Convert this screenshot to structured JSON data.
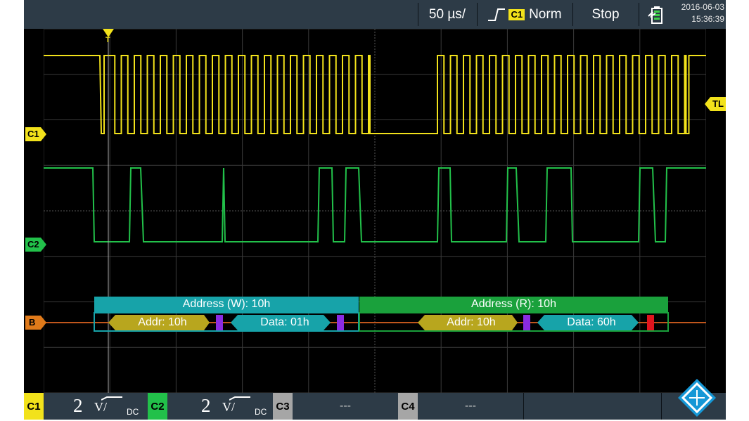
{
  "topbar": {
    "timebase": "50 µs/",
    "trigger_source": "C1",
    "trigger_mode": "Norm",
    "run_state": "Stop",
    "date": "2016-06-03",
    "time": "15:36:39"
  },
  "markers": {
    "trigger": "T",
    "trigger_level": "TL",
    "ch1": "C1",
    "ch2": "C2",
    "bus": "B"
  },
  "decode": {
    "frames": [
      {
        "header": "Address (W): 10h",
        "addr": "Addr: 10h",
        "data": "Data: 01h",
        "color": "#17a3a9"
      },
      {
        "header": "Address (R): 10h",
        "addr": "Addr: 10h",
        "data": "Data: 60h",
        "color": "#1aa13c"
      }
    ]
  },
  "channels": [
    {
      "tag": "C1",
      "scale": "2",
      "unit": "V/",
      "coupling": "DC",
      "color": "#f2e21b"
    },
    {
      "tag": "C2",
      "scale": "2",
      "unit": "V/",
      "coupling": "DC",
      "color": "#22c14a"
    },
    {
      "tag": "C3",
      "value": "---",
      "color": "#a6a6a6"
    },
    {
      "tag": "C4",
      "value": "---",
      "color": "#a6a6a6"
    }
  ],
  "colors": {
    "ch1": "#f2e21b",
    "ch2": "#22c14a",
    "bus": "#c0561c",
    "addr_segment": "#b8a61e",
    "data_segment": "#17a3a9",
    "ack": "#8a2be2",
    "nack": "#e0141e"
  },
  "icons": {
    "trigger_edge": "rising-edge-icon",
    "battery": "battery-charging-icon",
    "logo": "rohde-schwarz-logo"
  }
}
